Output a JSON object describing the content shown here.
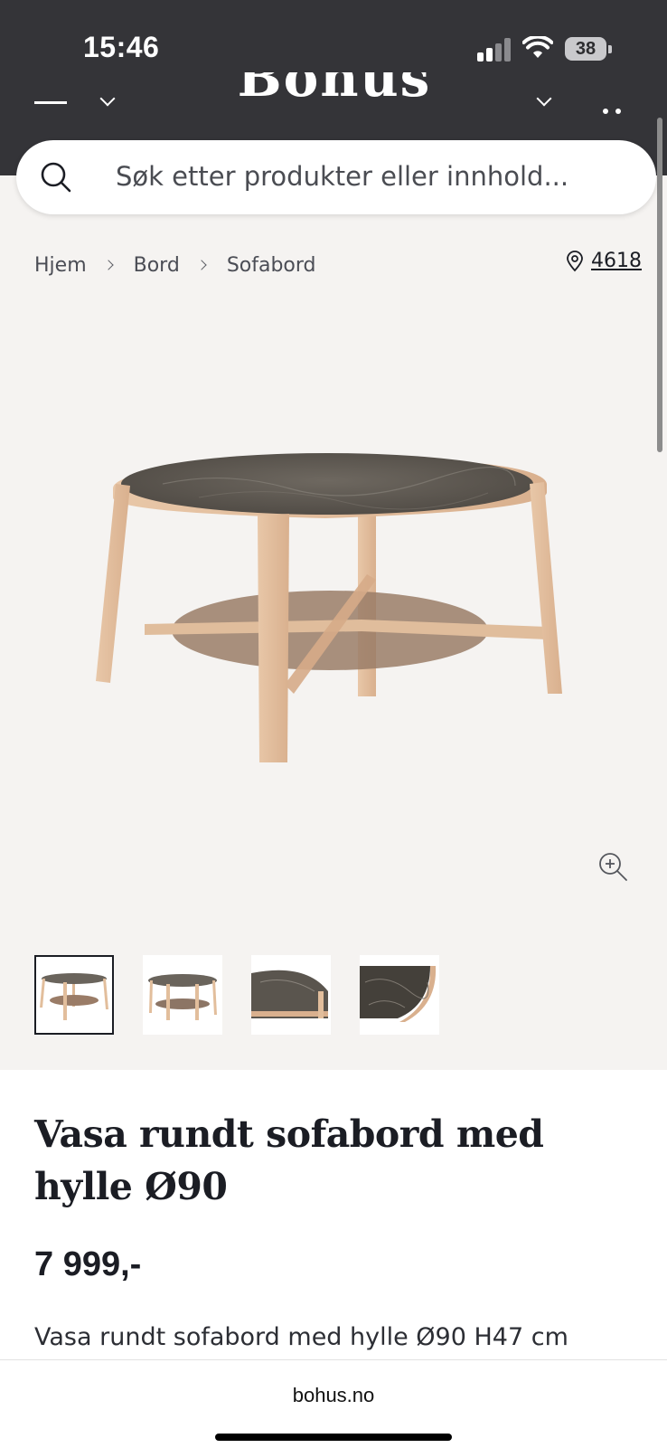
{
  "status_bar": {
    "time": "15:46",
    "battery": "38"
  },
  "header": {
    "logo_text": "Bohus"
  },
  "search": {
    "placeholder": "Søk etter produkter eller innhold..."
  },
  "breadcrumb": [
    {
      "label": "Hjem"
    },
    {
      "label": "Bord"
    },
    {
      "label": "Sofabord"
    }
  ],
  "store": {
    "number": "4618"
  },
  "product": {
    "title": "Vasa rundt sofabord med hylle Ø90",
    "price": "7 999,-",
    "description": "Vasa rundt sofabord med hylle Ø90 H47 cm",
    "image_count": 4,
    "selected_thumbnail": 1
  },
  "browser": {
    "url": "bohus.no"
  },
  "colors": {
    "header_bg": "#343438",
    "page_bg": "#f5f3f1",
    "text": "#1b1d24"
  }
}
